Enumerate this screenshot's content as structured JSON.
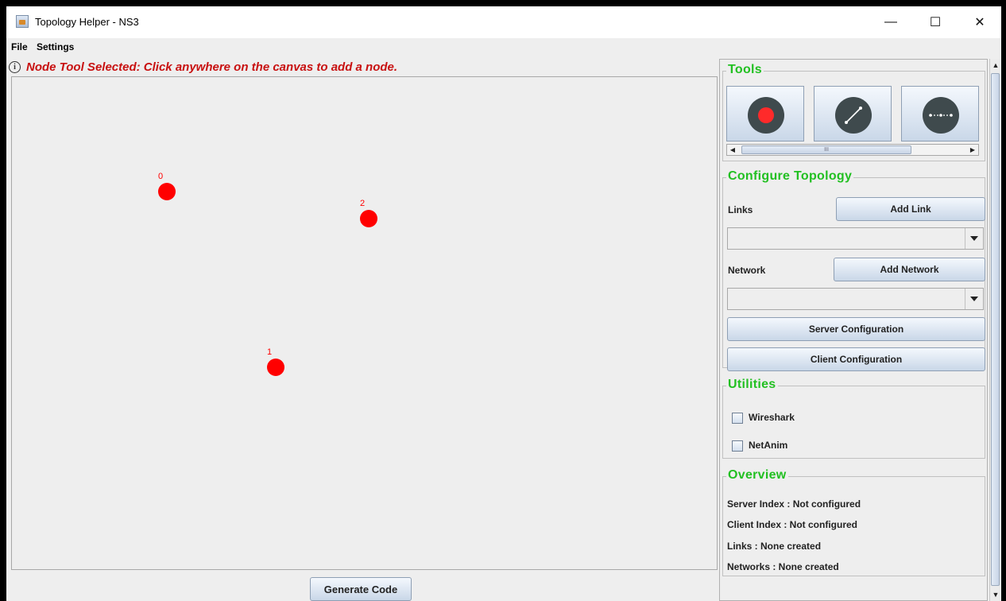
{
  "window": {
    "title": "Topology Helper - NS3",
    "minimize_icon": "—",
    "maximize_icon": "☐",
    "close_icon": "✕"
  },
  "menu": [
    "File",
    "Settings"
  ],
  "status": {
    "icon": "i",
    "message": "Node Tool Selected: Click anywhere on the canvas to add a node."
  },
  "canvas": {
    "nodes": [
      {
        "label": "0"
      },
      {
        "label": "2"
      },
      {
        "label": "1"
      }
    ]
  },
  "generate_label": "Generate Code",
  "tools": {
    "title": "Tools",
    "items": [
      {
        "name": "node-tool"
      },
      {
        "name": "link-tool"
      },
      {
        "name": "network-tool"
      }
    ],
    "hscroll_grip": "III"
  },
  "configure": {
    "title": "Configure Topology",
    "links_label": "Links",
    "add_link": "Add Link",
    "links_selected": "",
    "network_label": "Network",
    "add_network": "Add Network",
    "network_selected": "",
    "server_config": "Server Configuration",
    "client_config": "Client Configuration"
  },
  "utilities": {
    "title": "Utilities",
    "items": [
      "Wireshark",
      "NetAnim"
    ]
  },
  "overview": {
    "title": "Overview",
    "server_index": "Server Index :  Not configured",
    "client_index": "Client Index  : Not configured",
    "links": "Links :  None created",
    "networks": "Networks : None created"
  },
  "colors": {
    "node": "#ff0000",
    "status_text": "#c81010",
    "group_title": "#22c022",
    "tool_circle": "#3f4a4d"
  }
}
